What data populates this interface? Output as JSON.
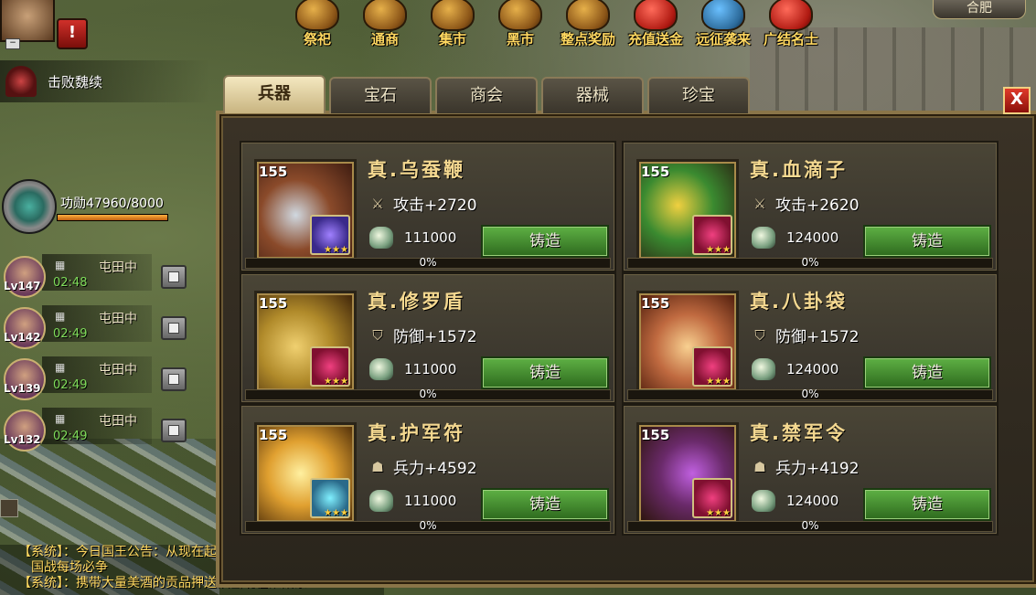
{
  "top_nav": [
    {
      "label": "祭祀",
      "icon": "cauldron-icon",
      "style": ""
    },
    {
      "label": "通商",
      "icon": "chest-icon",
      "style": ""
    },
    {
      "label": "集市",
      "icon": "market-icon",
      "style": ""
    },
    {
      "label": "黑市",
      "icon": "blackmarket-icon",
      "style": ""
    },
    {
      "label": "整点奖励",
      "icon": "bell-icon",
      "style": ""
    },
    {
      "label": "充值送金",
      "icon": "gift-icon",
      "style": "red"
    },
    {
      "label": "远征袭来",
      "icon": "expedition-icon",
      "style": "blue"
    },
    {
      "label": "广结名士",
      "icon": "lantern-icon",
      "style": "red"
    }
  ],
  "city": {
    "label": "合肥"
  },
  "alert": {
    "label": "!"
  },
  "defeat": {
    "text": "击败魏续"
  },
  "merit": {
    "text": "功勋47960/8000",
    "fill": 1.0
  },
  "farm": [
    {
      "level": "Lv147",
      "status": "屯田中",
      "time": "02:48"
    },
    {
      "level": "Lv142",
      "status": "屯田中",
      "time": "02:49"
    },
    {
      "level": "Lv139",
      "status": "屯田中",
      "time": "02:49"
    },
    {
      "level": "Lv132",
      "status": "屯田中",
      "time": "02:49"
    }
  ],
  "chat": {
    "line1": "【系统】：今日国王公告：从现在起，远征不留影子",
    "line2": "国战每场必争",
    "line3": "【系统】：携带大量美酒的贡品押送队出现在淮阳东"
  },
  "tabs": [
    {
      "label": "兵器",
      "active": true
    },
    {
      "label": "宝石",
      "active": false
    },
    {
      "label": "商会",
      "active": false
    },
    {
      "label": "器械",
      "active": false
    },
    {
      "label": "珍宝",
      "active": false
    }
  ],
  "close": {
    "label": "X"
  },
  "items": [
    {
      "level": "155",
      "name": "真.乌蚕鞭",
      "stat_icon": "sword-icon",
      "stat": "攻击+2720",
      "cost": "111000",
      "forge_label": "铸造",
      "progress_text": "0%",
      "progress": 0,
      "gem": "purple",
      "stars": "★★★"
    },
    {
      "level": "155",
      "name": "真.血滴子",
      "stat_icon": "sword-icon",
      "stat": "攻击+2620",
      "cost": "124000",
      "forge_label": "铸造",
      "progress_text": "0%",
      "progress": 0,
      "gem": "red",
      "stars": "★★★"
    },
    {
      "level": "155",
      "name": "真.修罗盾",
      "stat_icon": "shield-icon",
      "stat": "防御+1572",
      "cost": "111000",
      "forge_label": "铸造",
      "progress_text": "0%",
      "progress": 0,
      "gem": "red",
      "stars": "★★★"
    },
    {
      "level": "155",
      "name": "真.八卦袋",
      "stat_icon": "shield-icon",
      "stat": "防御+1572",
      "cost": "124000",
      "forge_label": "铸造",
      "progress_text": "0%",
      "progress": 0,
      "gem": "red",
      "stars": "★★★"
    },
    {
      "level": "155",
      "name": "真.护军符",
      "stat_icon": "soldier-icon",
      "stat": "兵力+4592",
      "cost": "111000",
      "forge_label": "铸造",
      "progress_text": "0%",
      "progress": 0,
      "gem": "teal",
      "stars": "★★★"
    },
    {
      "level": "155",
      "name": "真.禁军令",
      "stat_icon": "soldier-icon",
      "stat": "兵力+4192",
      "cost": "124000",
      "forge_label": "铸造",
      "progress_text": "0%",
      "progress": 0,
      "gem": "red",
      "stars": "★★★"
    }
  ]
}
